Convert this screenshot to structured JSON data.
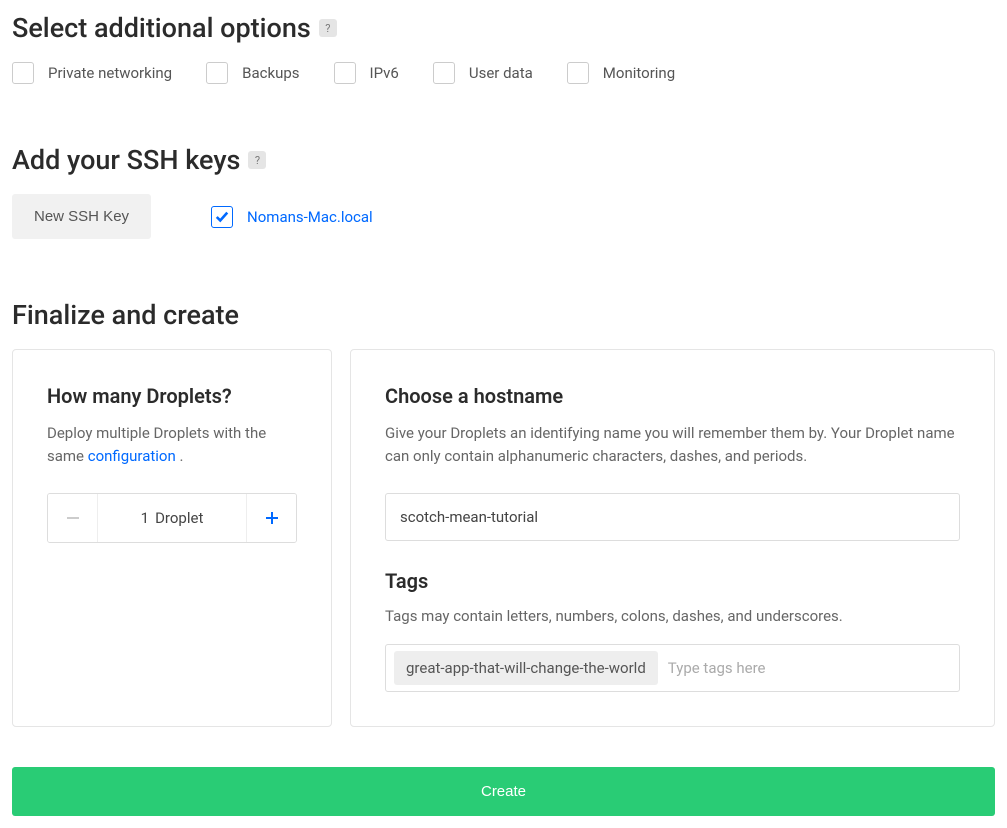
{
  "additional_options": {
    "title": "Select additional options",
    "help": "?",
    "items": [
      {
        "label": "Private networking",
        "checked": false
      },
      {
        "label": "Backups",
        "checked": false
      },
      {
        "label": "IPv6",
        "checked": false
      },
      {
        "label": "User data",
        "checked": false
      },
      {
        "label": "Monitoring",
        "checked": false
      }
    ]
  },
  "ssh_keys": {
    "title": "Add your SSH keys",
    "help": "?",
    "new_button": "New SSH Key",
    "keys": [
      {
        "name": "Nomans-Mac.local",
        "checked": true
      }
    ]
  },
  "finalize": {
    "title": "Finalize and create",
    "how_many": {
      "title": "How many Droplets?",
      "desc_prefix": "Deploy multiple Droplets with the same ",
      "desc_link": "configuration",
      "desc_suffix": " .",
      "count": "1",
      "unit": "Droplet"
    },
    "hostname": {
      "title": "Choose a hostname",
      "desc": "Give your Droplets an identifying name you will remember them by. Your Droplet name can only contain alphanumeric characters, dashes, and periods.",
      "value": "scotch-mean-tutorial"
    },
    "tags": {
      "title": "Tags",
      "desc": "Tags may contain letters, numbers, colons, dashes, and underscores.",
      "chips": [
        "great-app-that-will-change-the-world"
      ],
      "placeholder": "Type tags here"
    }
  },
  "create_button": "Create"
}
